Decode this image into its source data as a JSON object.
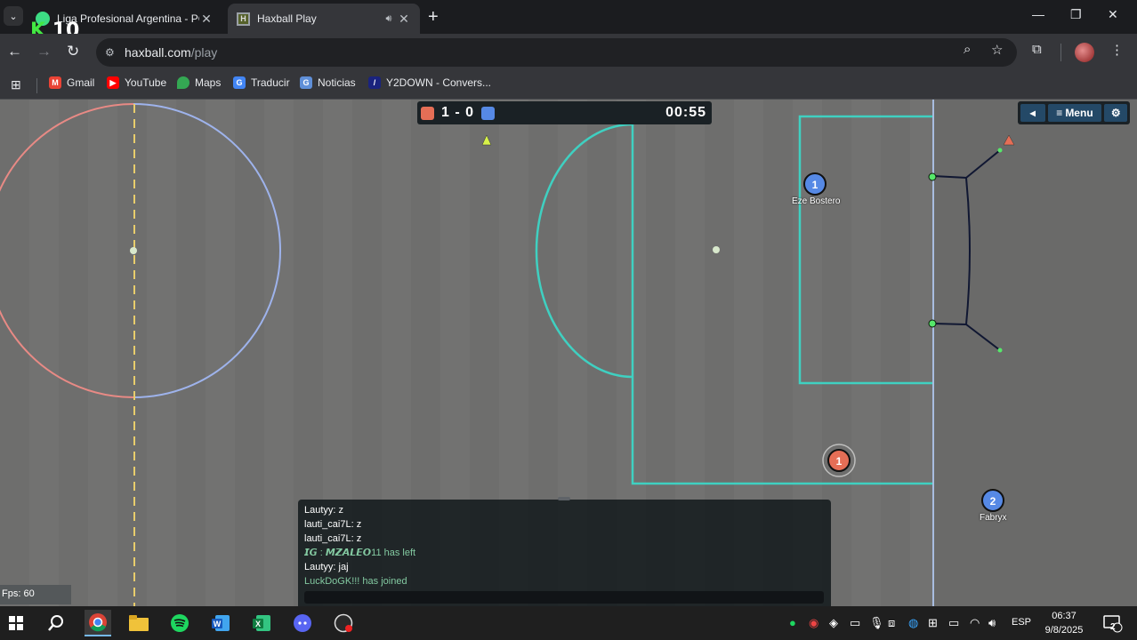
{
  "browser": {
    "tabs": [
      {
        "title": "Liga Profesional Argentina - PC",
        "active": false
      },
      {
        "title": "Haxball Play",
        "active": true
      }
    ],
    "overlay_text": "10",
    "url_host": "haxball.com",
    "url_path": "/play",
    "bookmarks": [
      "Gmail",
      "YouTube",
      "Maps",
      "Traducir",
      "Noticias",
      "Y2DOWN - Convers..."
    ]
  },
  "game": {
    "score": "1 - 0",
    "timer": "00:55",
    "menu_label": "Menu",
    "fps": "Fps: 60",
    "team_colors": {
      "red": "#e56e56",
      "blue": "#5689e5"
    },
    "players": [
      {
        "number": "1",
        "name": "Eze Bostero",
        "team": "blue"
      },
      {
        "number": "1",
        "name": "",
        "team": "red"
      },
      {
        "number": "2",
        "name": "Fabryx",
        "team": "blue"
      }
    ]
  },
  "chat": {
    "lines": [
      {
        "text": "Lautyy: z",
        "kind": "msg"
      },
      {
        "text": "lauti_cai7L: z",
        "kind": "msg"
      },
      {
        "text": "lauti_cai7L: z",
        "kind": "msg"
      },
      {
        "text": "𝙄𝙂 : 𝙈𝙕𝘼𝙇𝙀𝙊11 has left",
        "kind": "notice"
      },
      {
        "text": "Lautyy: jaj",
        "kind": "msg"
      },
      {
        "text": "LuckDoGK!!! has joined",
        "kind": "notice"
      }
    ]
  },
  "taskbar": {
    "language": "ESP",
    "time": "06:37",
    "date": "9/8/2025",
    "notification_count": "2"
  }
}
